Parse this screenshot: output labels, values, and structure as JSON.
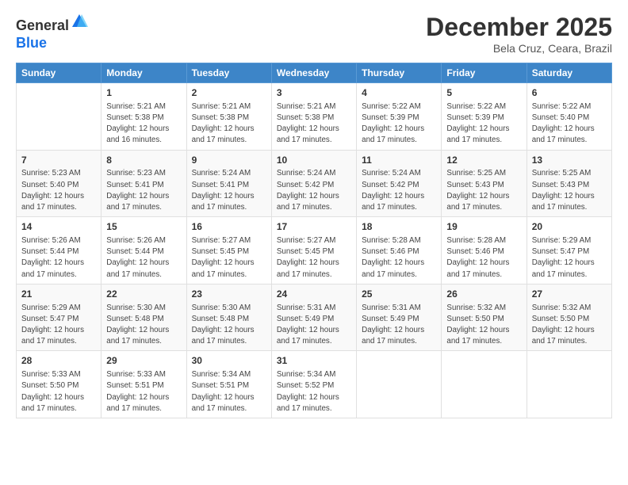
{
  "header": {
    "logo_line1": "General",
    "logo_line2": "Blue",
    "month": "December 2025",
    "location": "Bela Cruz, Ceara, Brazil"
  },
  "weekdays": [
    "Sunday",
    "Monday",
    "Tuesday",
    "Wednesday",
    "Thursday",
    "Friday",
    "Saturday"
  ],
  "weeks": [
    [
      {
        "day": "",
        "info": ""
      },
      {
        "day": "1",
        "info": "Sunrise: 5:21 AM\nSunset: 5:38 PM\nDaylight: 12 hours\nand 16 minutes."
      },
      {
        "day": "2",
        "info": "Sunrise: 5:21 AM\nSunset: 5:38 PM\nDaylight: 12 hours\nand 17 minutes."
      },
      {
        "day": "3",
        "info": "Sunrise: 5:21 AM\nSunset: 5:38 PM\nDaylight: 12 hours\nand 17 minutes."
      },
      {
        "day": "4",
        "info": "Sunrise: 5:22 AM\nSunset: 5:39 PM\nDaylight: 12 hours\nand 17 minutes."
      },
      {
        "day": "5",
        "info": "Sunrise: 5:22 AM\nSunset: 5:39 PM\nDaylight: 12 hours\nand 17 minutes."
      },
      {
        "day": "6",
        "info": "Sunrise: 5:22 AM\nSunset: 5:40 PM\nDaylight: 12 hours\nand 17 minutes."
      }
    ],
    [
      {
        "day": "7",
        "info": "Sunrise: 5:23 AM\nSunset: 5:40 PM\nDaylight: 12 hours\nand 17 minutes."
      },
      {
        "day": "8",
        "info": "Sunrise: 5:23 AM\nSunset: 5:41 PM\nDaylight: 12 hours\nand 17 minutes."
      },
      {
        "day": "9",
        "info": "Sunrise: 5:24 AM\nSunset: 5:41 PM\nDaylight: 12 hours\nand 17 minutes."
      },
      {
        "day": "10",
        "info": "Sunrise: 5:24 AM\nSunset: 5:42 PM\nDaylight: 12 hours\nand 17 minutes."
      },
      {
        "day": "11",
        "info": "Sunrise: 5:24 AM\nSunset: 5:42 PM\nDaylight: 12 hours\nand 17 minutes."
      },
      {
        "day": "12",
        "info": "Sunrise: 5:25 AM\nSunset: 5:43 PM\nDaylight: 12 hours\nand 17 minutes."
      },
      {
        "day": "13",
        "info": "Sunrise: 5:25 AM\nSunset: 5:43 PM\nDaylight: 12 hours\nand 17 minutes."
      }
    ],
    [
      {
        "day": "14",
        "info": "Sunrise: 5:26 AM\nSunset: 5:44 PM\nDaylight: 12 hours\nand 17 minutes."
      },
      {
        "day": "15",
        "info": "Sunrise: 5:26 AM\nSunset: 5:44 PM\nDaylight: 12 hours\nand 17 minutes."
      },
      {
        "day": "16",
        "info": "Sunrise: 5:27 AM\nSunset: 5:45 PM\nDaylight: 12 hours\nand 17 minutes."
      },
      {
        "day": "17",
        "info": "Sunrise: 5:27 AM\nSunset: 5:45 PM\nDaylight: 12 hours\nand 17 minutes."
      },
      {
        "day": "18",
        "info": "Sunrise: 5:28 AM\nSunset: 5:46 PM\nDaylight: 12 hours\nand 17 minutes."
      },
      {
        "day": "19",
        "info": "Sunrise: 5:28 AM\nSunset: 5:46 PM\nDaylight: 12 hours\nand 17 minutes."
      },
      {
        "day": "20",
        "info": "Sunrise: 5:29 AM\nSunset: 5:47 PM\nDaylight: 12 hours\nand 17 minutes."
      }
    ],
    [
      {
        "day": "21",
        "info": "Sunrise: 5:29 AM\nSunset: 5:47 PM\nDaylight: 12 hours\nand 17 minutes."
      },
      {
        "day": "22",
        "info": "Sunrise: 5:30 AM\nSunset: 5:48 PM\nDaylight: 12 hours\nand 17 minutes."
      },
      {
        "day": "23",
        "info": "Sunrise: 5:30 AM\nSunset: 5:48 PM\nDaylight: 12 hours\nand 17 minutes."
      },
      {
        "day": "24",
        "info": "Sunrise: 5:31 AM\nSunset: 5:49 PM\nDaylight: 12 hours\nand 17 minutes."
      },
      {
        "day": "25",
        "info": "Sunrise: 5:31 AM\nSunset: 5:49 PM\nDaylight: 12 hours\nand 17 minutes."
      },
      {
        "day": "26",
        "info": "Sunrise: 5:32 AM\nSunset: 5:50 PM\nDaylight: 12 hours\nand 17 minutes."
      },
      {
        "day": "27",
        "info": "Sunrise: 5:32 AM\nSunset: 5:50 PM\nDaylight: 12 hours\nand 17 minutes."
      }
    ],
    [
      {
        "day": "28",
        "info": "Sunrise: 5:33 AM\nSunset: 5:50 PM\nDaylight: 12 hours\nand 17 minutes."
      },
      {
        "day": "29",
        "info": "Sunrise: 5:33 AM\nSunset: 5:51 PM\nDaylight: 12 hours\nand 17 minutes."
      },
      {
        "day": "30",
        "info": "Sunrise: 5:34 AM\nSunset: 5:51 PM\nDaylight: 12 hours\nand 17 minutes."
      },
      {
        "day": "31",
        "info": "Sunrise: 5:34 AM\nSunset: 5:52 PM\nDaylight: 12 hours\nand 17 minutes."
      },
      {
        "day": "",
        "info": ""
      },
      {
        "day": "",
        "info": ""
      },
      {
        "day": "",
        "info": ""
      }
    ]
  ]
}
